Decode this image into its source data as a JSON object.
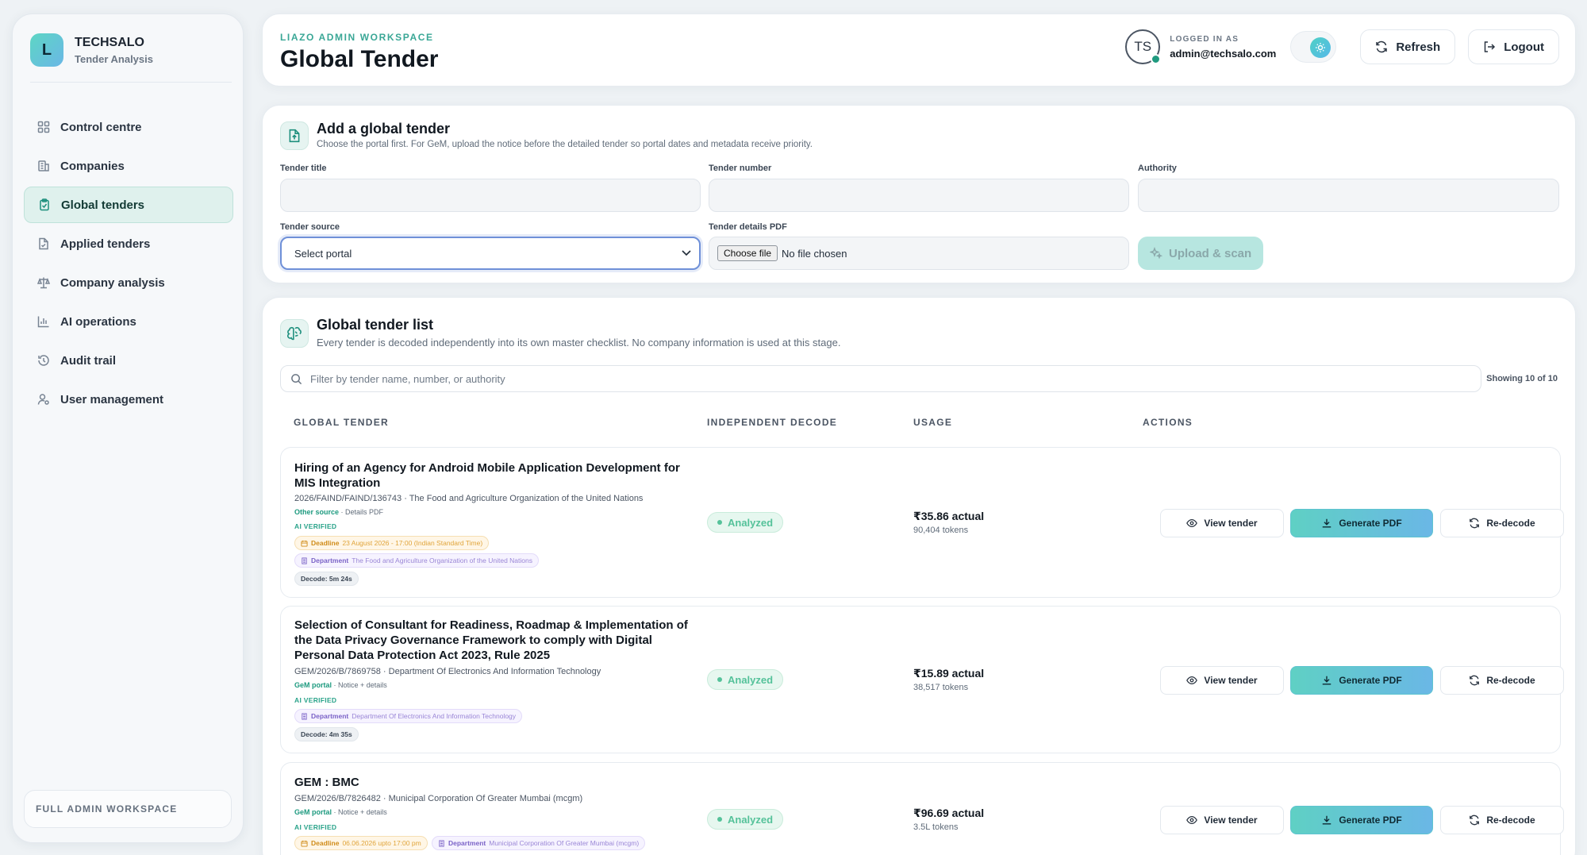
{
  "brand": {
    "logo_letter": "L",
    "name": "TECHSALO",
    "subtitle": "Tender Analysis"
  },
  "sidebar": {
    "items": [
      {
        "label": "Control centre",
        "icon": "grid-icon",
        "active": false
      },
      {
        "label": "Companies",
        "icon": "building-icon",
        "active": false
      },
      {
        "label": "Global tenders",
        "icon": "clipboard-icon",
        "active": true
      },
      {
        "label": "Applied tenders",
        "icon": "file-icon",
        "active": false
      },
      {
        "label": "Company analysis",
        "icon": "scale-icon",
        "active": false
      },
      {
        "label": "AI operations",
        "icon": "bar-chart-icon",
        "active": false
      },
      {
        "label": "Audit trail",
        "icon": "history-icon",
        "active": false
      },
      {
        "label": "User management",
        "icon": "user-gear-icon",
        "active": false
      }
    ],
    "footer": "FULL ADMIN WORKSPACE"
  },
  "header": {
    "eyebrow": "LIAZO ADMIN WORKSPACE",
    "title": "Global Tender",
    "avatar_initials": "TS",
    "logged_label": "LOGGED IN AS",
    "logged_email": "admin@techsalo.com",
    "refresh_label": "Refresh",
    "logout_label": "Logout"
  },
  "add_form": {
    "title": "Add a global tender",
    "subtitle": "Choose the portal first. For GeM, upload the notice before the detailed tender so portal dates and metadata receive priority.",
    "tender_title_label": "Tender title",
    "tender_title_value": "",
    "tender_number_label": "Tender number",
    "tender_number_value": "",
    "authority_label": "Authority",
    "authority_value": "",
    "source_label": "Tender source",
    "source_value": "Select portal",
    "pdf_label": "Tender details PDF",
    "file_button": "Choose file",
    "file_status": "No file chosen",
    "upload_label": "Upload & scan"
  },
  "list": {
    "title": "Global tender list",
    "subtitle": "Every tender is decoded independently into its own master checklist. No company information is used at this stage.",
    "search_placeholder": "Filter by tender name, number, or authority",
    "showing": "Showing 10 of 10",
    "columns": [
      "GLOBAL TENDER",
      "INDEPENDENT DECODE",
      "USAGE",
      "ACTIONS"
    ],
    "actions": {
      "view": "View tender",
      "generate": "Generate PDF",
      "redecode": "Re-decode"
    },
    "rows": [
      {
        "title": "Hiring of an Agency for Android Mobile Application Development for MIS Integration",
        "meta": "2026/FAIND/FAIND/136743 · The Food and Agriculture Organization of the United Nations",
        "source_name": "Other source",
        "source_detail": " · Details PDF",
        "ai_verified": "AI VERIFIED",
        "deadline_label": "Deadline",
        "deadline_value": "23 August 2026 - 17:00 (Indian Standard Time)",
        "dept_label": "Department",
        "dept_value": "The Food and Agriculture Organization of the United Nations",
        "decode": "Decode: 5m 24s",
        "status": "Analyzed",
        "usage_amount": "₹35.86 actual",
        "usage_tokens": "90,404 tokens"
      },
      {
        "title": "Selection of Consultant for Readiness, Roadmap & Implementation of the Data Privacy Governance Framework to comply with Digital Personal Data Protection Act 2023, Rule 2025",
        "meta": "GEM/2026/B/7869758 · Department Of Electronics And Information Technology",
        "source_name": "GeM portal",
        "source_detail": " · Notice + details",
        "ai_verified": "AI VERIFIED",
        "dept_label": "Department",
        "dept_value": "Department Of Electronics And Information Technology",
        "decode": "Decode: 4m 35s",
        "status": "Analyzed",
        "usage_amount": "₹15.89 actual",
        "usage_tokens": "38,517 tokens"
      },
      {
        "title": "GEM : BMC",
        "meta": "GEM/2026/B/7826482 · Municipal Corporation Of Greater Mumbai (mcgm)",
        "source_name": "GeM portal",
        "source_detail": " · Notice + details",
        "ai_verified": "AI VERIFIED",
        "deadline_label": "Deadline",
        "deadline_value": "06.06.2026 upto 17:00 pm",
        "dept_label": "Department",
        "dept_value": "Municipal Corporation Of Greater Mumbai (mcgm)",
        "status": "Analyzed",
        "usage_amount": "₹96.69 actual",
        "usage_tokens": "3.5L tokens"
      }
    ]
  }
}
